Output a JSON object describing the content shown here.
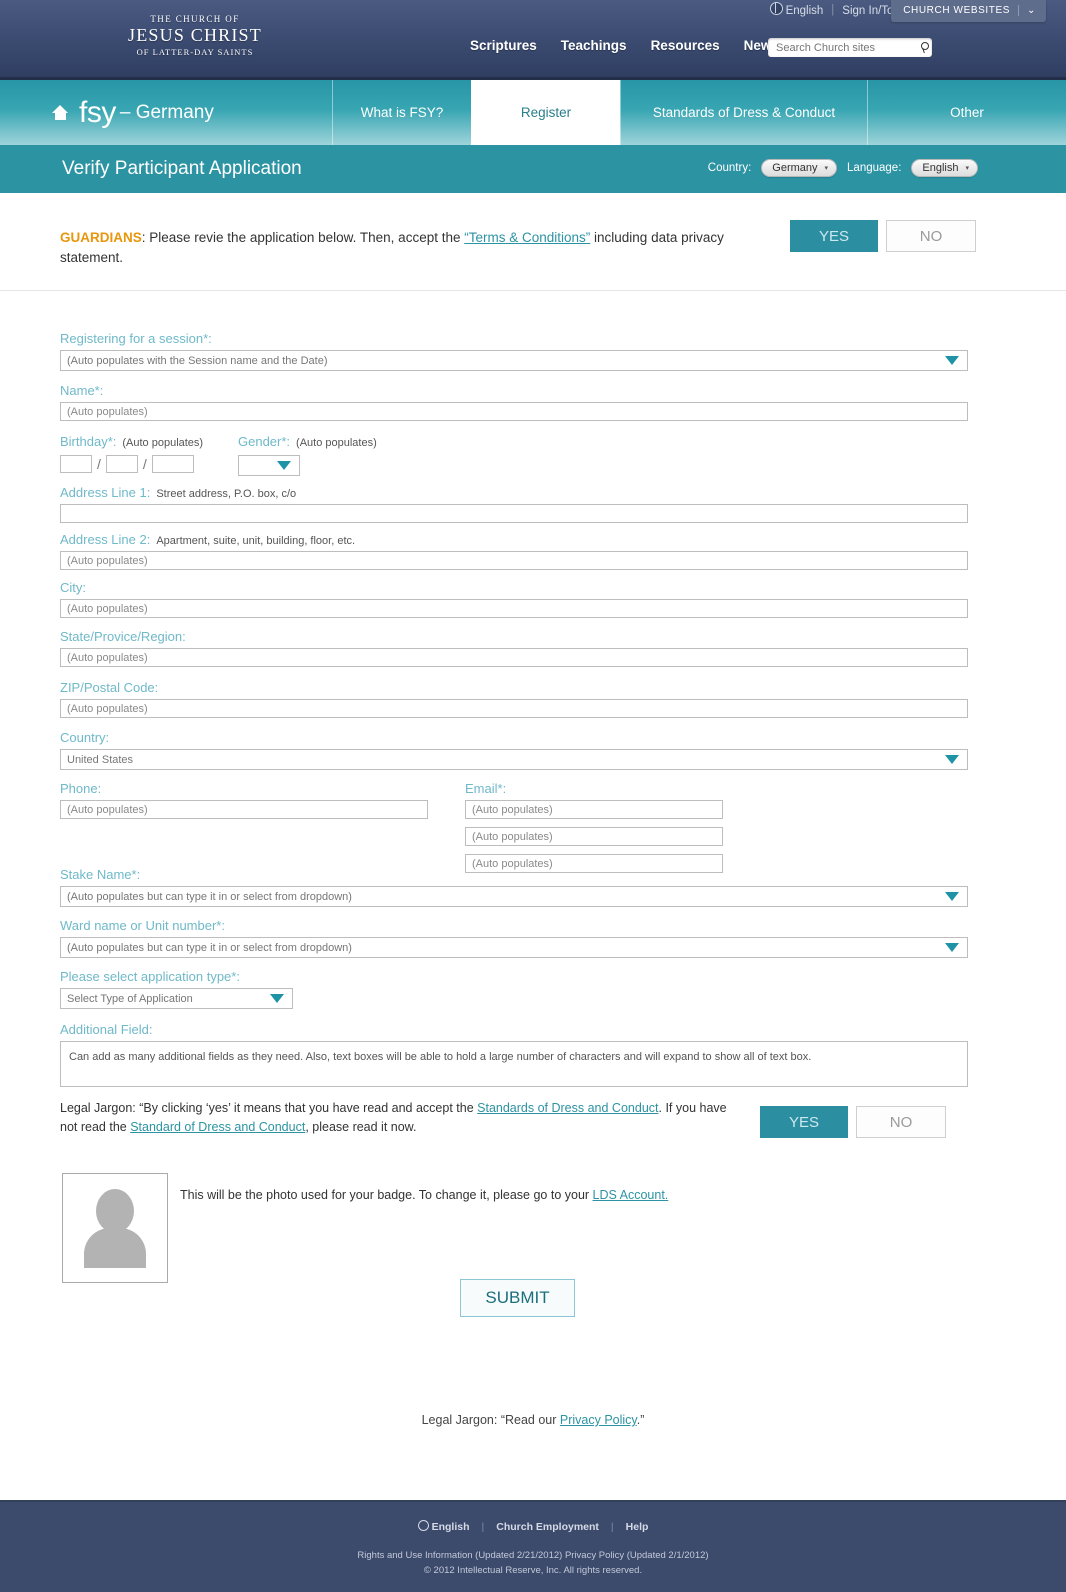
{
  "church_header": {
    "logo": {
      "line1": "THE CHURCH OF",
      "line2": "JESUS CHRIST",
      "line3": "OF LATTER-DAY SAINTS"
    },
    "utility": {
      "language": "English",
      "signin": "Sign In/Tools",
      "signin_caret": "⌄",
      "church_websites": "CHURCH WEBSITES",
      "church_websites_caret": "⌄"
    },
    "nav": [
      {
        "label": "Scriptures"
      },
      {
        "label": "Teachings"
      },
      {
        "label": "Resources"
      },
      {
        "label": "News"
      }
    ],
    "search": {
      "placeholder": "Search Church sites",
      "value": ""
    }
  },
  "fsy_nav": {
    "brand_mark": "fsy",
    "brand_country": "– Germany",
    "tabs": [
      {
        "label": "What is FSY?",
        "active": false
      },
      {
        "label": "Register",
        "active": true
      },
      {
        "label": "Standards of Dress & Conduct",
        "active": false
      },
      {
        "label": "Other",
        "active": false
      }
    ]
  },
  "title_bar": {
    "title": "Verify Participant Application",
    "country_label": "Country:",
    "country_value": "Germany",
    "language_label": "Language:",
    "language_value": "English",
    "caret": "▾"
  },
  "guardian": {
    "label": "GUARDIANS",
    "text_before": ": Please revie the application below. Then, accept the ",
    "link": "“Terms & Conditions”",
    "text_after": " including data privacy statement.",
    "yes_label": "YES",
    "no_label": "NO"
  },
  "form": {
    "session": {
      "label": "Registering for a session*:",
      "value": "(Auto populates with the Session name and the Date)"
    },
    "name": {
      "label": "Name*:",
      "value": "(Auto populates)"
    },
    "birthday": {
      "label": "Birthday*:",
      "hint": "(Auto populates)",
      "month": "",
      "day": "",
      "year": ""
    },
    "gender": {
      "label": "Gender*:",
      "hint": "(Auto populates)",
      "value": ""
    },
    "address1": {
      "label": "Address Line 1:",
      "hint": "Street address, P.O. box, c/o",
      "value": ""
    },
    "address2": {
      "label": "Address Line 2:",
      "hint": "Apartment, suite, unit, building, floor, etc.",
      "value": "(Auto populates)"
    },
    "city": {
      "label": "City:",
      "value": "(Auto populates)"
    },
    "state": {
      "label": "State/Provice/Region:",
      "value": "(Auto populates)"
    },
    "zip": {
      "label": "ZIP/Postal Code:",
      "value": "(Auto populates)"
    },
    "country": {
      "label": "Country:",
      "value": "United States"
    },
    "phone": {
      "label": "Phone:",
      "value": "(Auto populates)"
    },
    "email": {
      "label": "Email*:",
      "value1": "(Auto populates)",
      "value2": "(Auto populates)",
      "value3": "(Auto populates)"
    },
    "stake": {
      "label": "Stake Name*:",
      "value": "(Auto populates but can type it in or select from dropdown)"
    },
    "ward": {
      "label": "Ward name or Unit number*:",
      "value": "(Auto populates but can type it in or select from dropdown)"
    },
    "app_type": {
      "label": "Please select application type*:",
      "value": "Select Type of Application"
    },
    "additional": {
      "label": "Additional Field:",
      "value": "Can add as many additional fields as they need. Also, text boxes will be able to hold a large number of characters and will expand to show all of text box."
    }
  },
  "legal": {
    "text_1": "Legal Jargon: “By clicking ‘yes’ it means that you have read and accept the ",
    "link_1": "Standards of Dress and Conduct",
    "text_2": ". If you have not read the ",
    "link_2": "Standard of Dress and Conduct",
    "text_3": ", please read it now.",
    "yes_label": "YES",
    "no_label": "NO"
  },
  "photo": {
    "caption_before": "This will be the photo used for your badge. To change it, please go to your ",
    "caption_link": "LDS Account."
  },
  "submit": {
    "label": "SUBMIT"
  },
  "privacy": {
    "text_before": "Legal Jargon: “Read our ",
    "link": "Privacy Policy",
    "text_after": ".”"
  },
  "footer": {
    "links": [
      {
        "label": "English"
      },
      {
        "label": "Church Employment"
      },
      {
        "label": "Help"
      }
    ],
    "legal_line1": "Rights and Use Information (Updated 2/21/2012)  Privacy Policy (Updated 2/1/2012)",
    "legal_line2": "© 2012 Intellectual Reserve, Inc. All rights reserved."
  },
  "colors": {
    "header_navy": "#3e4e74",
    "fsy_teal": "#2795a6",
    "title_teal": "#2c93a3",
    "label_blue": "#6fb9c9",
    "accent_orange": "#e8960c",
    "link_teal": "#2c93a3",
    "footer_navy": "#3c4a6b"
  }
}
